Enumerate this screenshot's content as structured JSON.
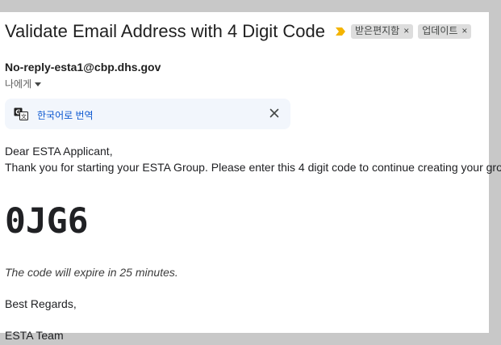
{
  "email": {
    "subject": "Validate Email Address with 4 Digit Code",
    "labels": [
      {
        "text": "받은편지함",
        "remove": "×"
      },
      {
        "text": "업데이트",
        "remove": "×"
      }
    ],
    "sender": "No-reply-esta1@cbp.dhs.gov",
    "recipient": "나에게",
    "translate": {
      "link_text": "한국어로 번역",
      "icon": "translate-icon",
      "close_icon": "close-icon"
    },
    "body": {
      "greeting": "Dear ESTA Applicant,",
      "intro": "Thank you for starting your ESTA Group. Please enter this 4 digit code to continue creating your group:",
      "code": "0JG6",
      "expiry": "The code will expire in 25 minutes.",
      "regards": "Best Regards,",
      "team": "ESTA Team"
    }
  },
  "colors": {
    "importance_marker": "#f4b400",
    "translate_link": "#0b57d0",
    "translate_bar_bg": "#f2f6fc",
    "label_chip_bg": "#dddddd"
  }
}
